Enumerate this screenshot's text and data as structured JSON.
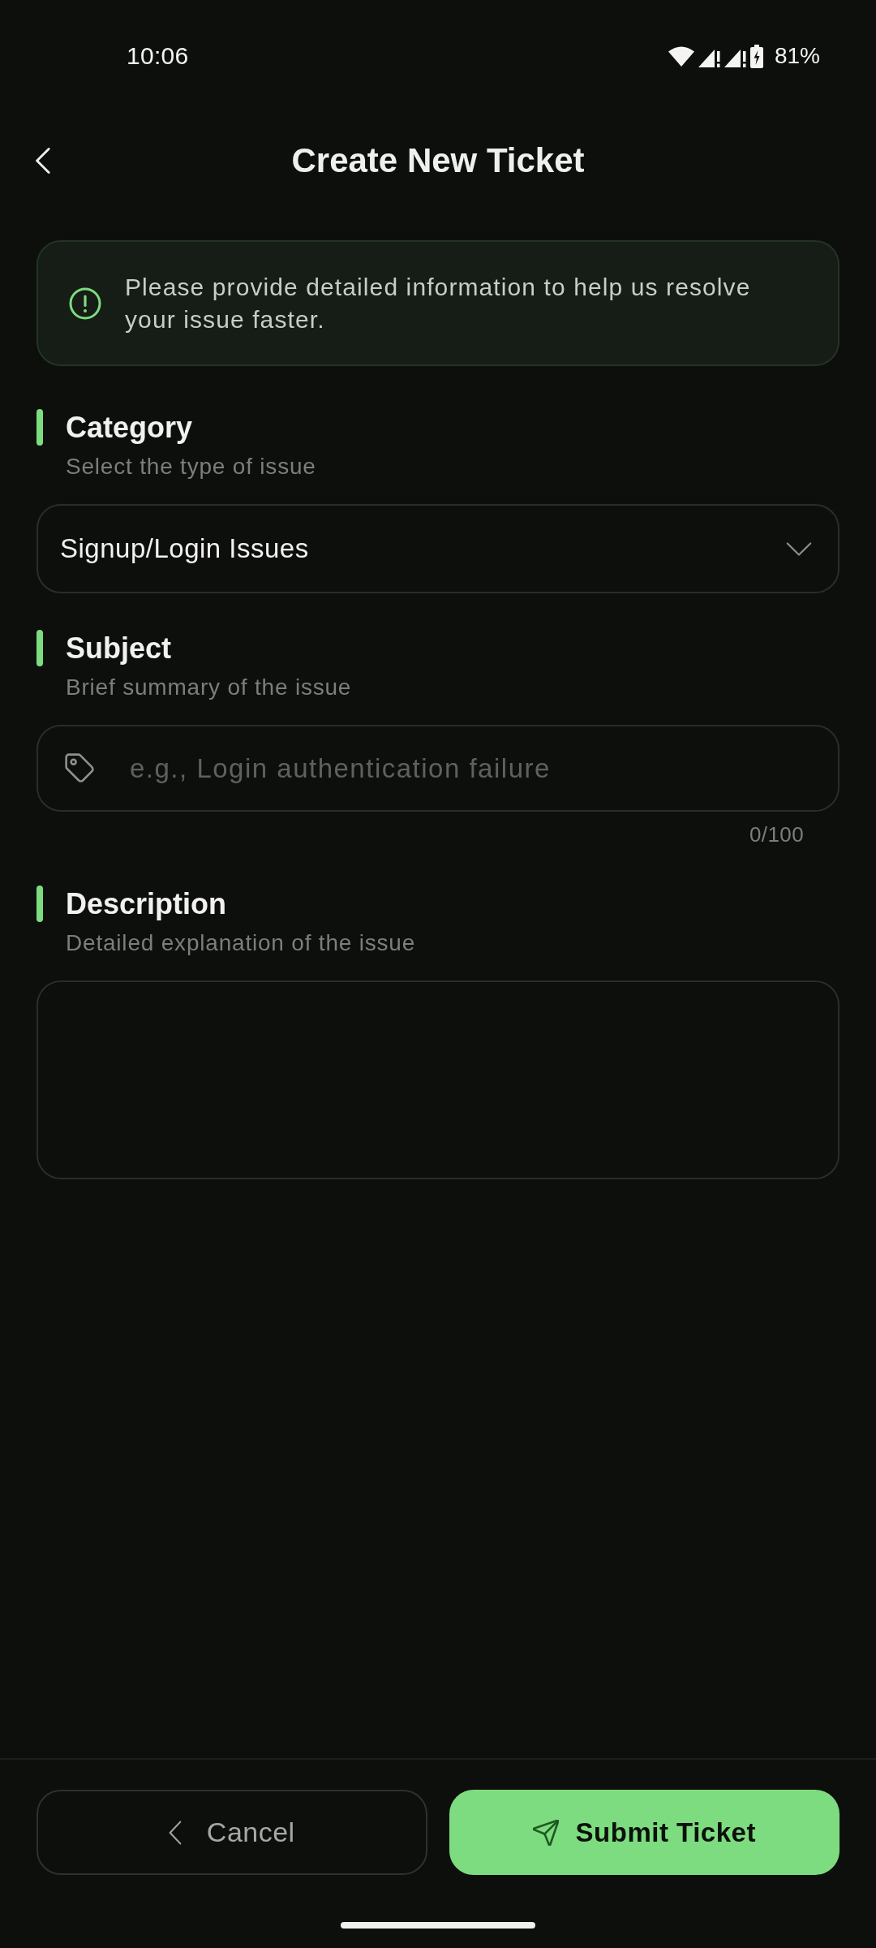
{
  "status_bar": {
    "time": "10:06",
    "battery": "81%"
  },
  "header": {
    "title": "Create New Ticket"
  },
  "notice": {
    "text": "Please provide detailed information to help us resolve your issue faster."
  },
  "sections": [
    {
      "kind": "select",
      "title": "Category",
      "subtitle": "Select the type of issue",
      "value": "Signup/Login Issues"
    },
    {
      "kind": "text",
      "title": "Subject",
      "subtitle": "Brief summary of the issue",
      "placeholder": "e.g., Login authentication failure",
      "counter": "0/100"
    },
    {
      "kind": "textarea",
      "title": "Description",
      "subtitle": "Detailed explanation of the issue"
    }
  ],
  "actions": [
    {
      "kind": "secondary",
      "label": "Cancel"
    },
    {
      "kind": "primary",
      "label": "Submit Ticket"
    }
  ]
}
